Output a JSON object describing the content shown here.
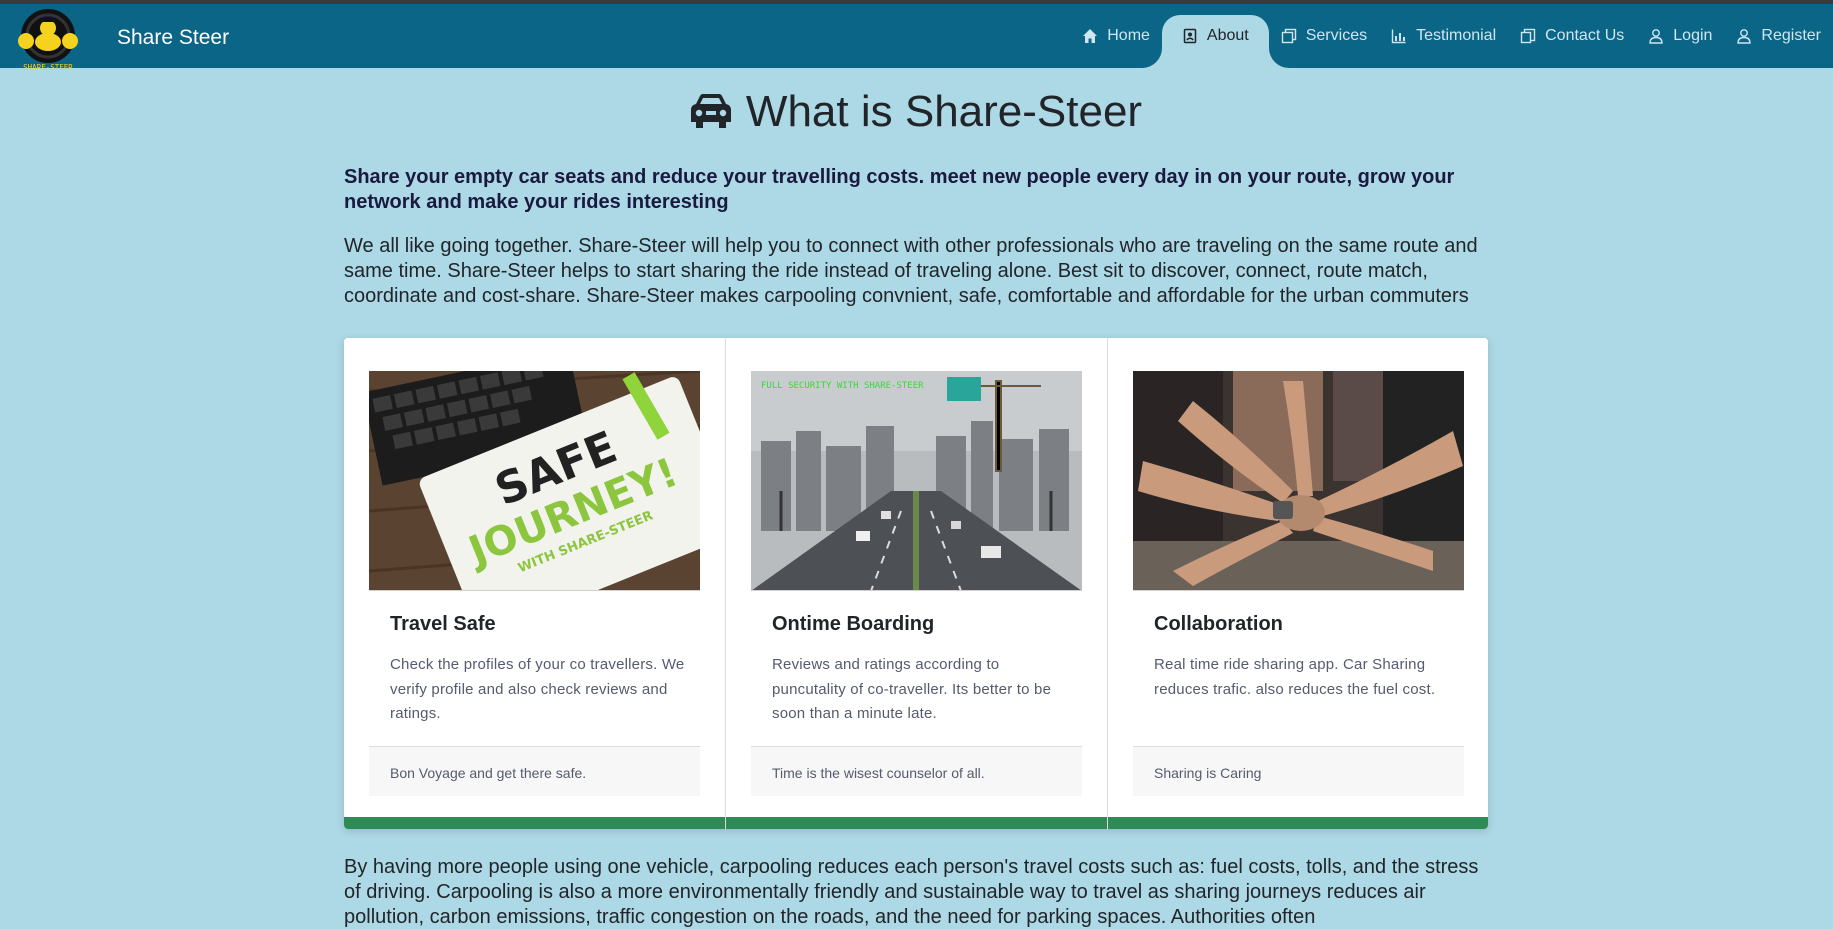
{
  "brand": {
    "name": "Share Steer",
    "logo_text": "SHARE-STEER"
  },
  "nav": [
    {
      "label": "Home",
      "icon": "home-icon"
    },
    {
      "label": "About",
      "icon": "contact-book-icon",
      "active": true
    },
    {
      "label": "Services",
      "icon": "copy-icon"
    },
    {
      "label": "Testimonial",
      "icon": "bar-chart-icon"
    },
    {
      "label": "Contact Us",
      "icon": "contact-copy-icon"
    },
    {
      "label": "Login",
      "icon": "user-icon"
    },
    {
      "label": "Register",
      "icon": "user-icon"
    }
  ],
  "main": {
    "title": "What is Share-Steer",
    "title_icon": "taxi-icon",
    "lead": "Share your empty car seats and reduce your travelling costs. meet new people every day in on your route, grow your network and make your rides interesting",
    "intro": "We all like going together. Share-Steer will help you to connect with other professionals who are traveling on the same route and same time. Share-Steer helps to start sharing the ride instead of traveling alone. Best sit to discover, connect, route match, coordinate and cost-share. Share-Steer makes carpooling convnient, safe, comfortable and affordable for the urban commuters",
    "outro": "By having more people using one vehicle, carpooling reduces each person's travel costs such as: fuel costs, tolls, and the stress of driving. Carpooling is also a more environmentally friendly and sustainable way to travel as sharing journeys reduces air pollution, carbon emissions, traffic congestion on the roads, and the need for parking spaces. Authorities often"
  },
  "cards": [
    {
      "title": "Travel Safe",
      "text": "Check the profiles of your co travellers. We verify profile and also check reviews and ratings.",
      "footer": "Bon Voyage and get there safe.",
      "image_text": {
        "line1": "SAFE",
        "line2": "JOURNEY!",
        "line3": "WITH SHARE-STEER"
      }
    },
    {
      "title": "Ontime Boarding",
      "text": "Reviews and ratings according to puncutality of co-traveller. Its better to be soon than a minute late.",
      "footer": "Time is the wisest counselor of all.",
      "image_text": {
        "line1": "FULL SECURITY WITH SHARE-STEER"
      }
    },
    {
      "title": "Collaboration",
      "text": "Real time ride sharing app. Car Sharing reduces trafic. also reduces the fuel cost.",
      "footer": "Sharing is Caring"
    }
  ],
  "colors": {
    "navbar": "#0a6587",
    "page_bg": "#add8e6",
    "card_bar": "#2e8b57"
  }
}
